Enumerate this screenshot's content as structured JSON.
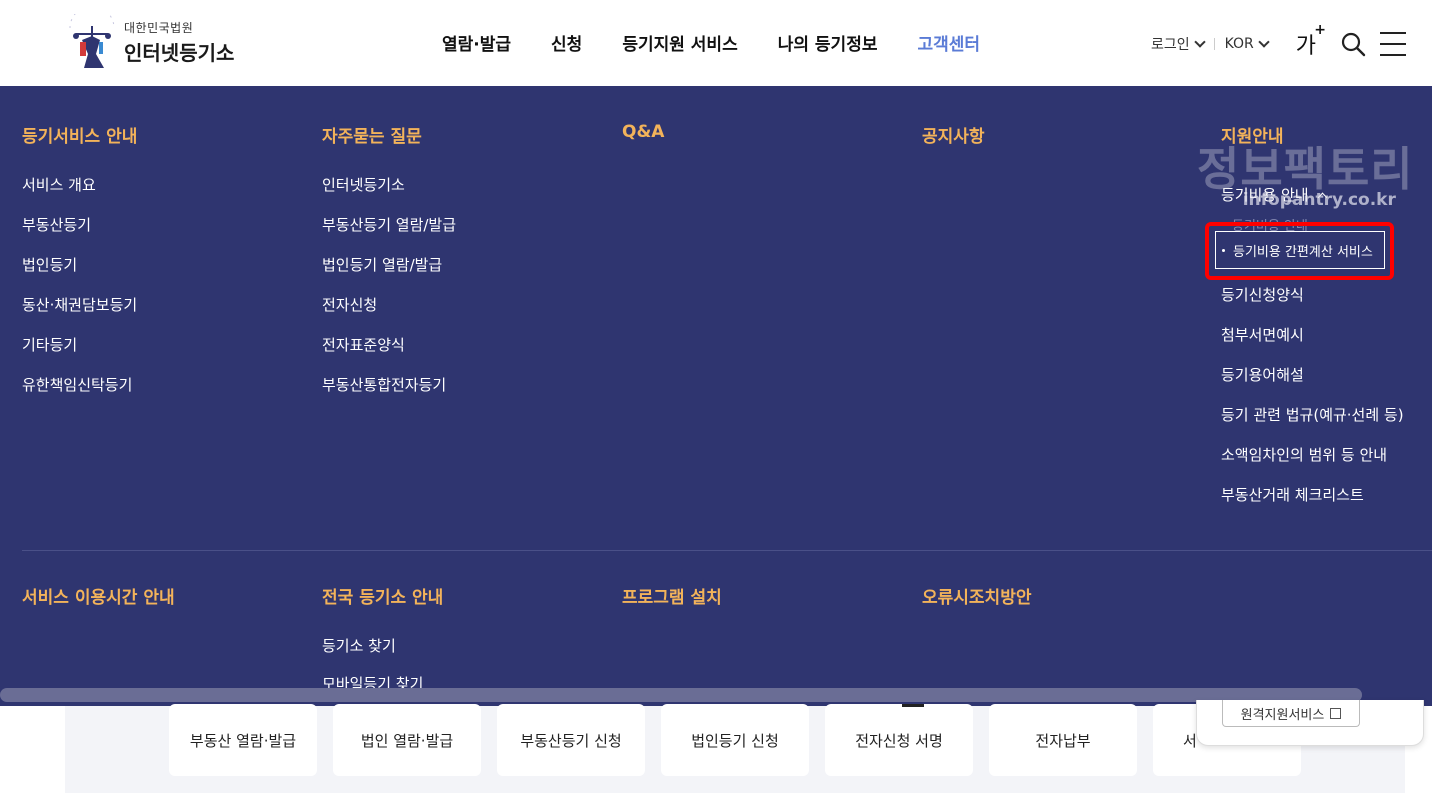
{
  "header": {
    "logo_sub": "대한민국법원",
    "logo_main": "인터넷등기소",
    "nav": [
      "열람·발급",
      "신청",
      "등기지원 서비스",
      "나의 등기정보",
      "고객센터"
    ],
    "active_nav": "고객센터",
    "login_label": "로그인",
    "lang_label": "KOR",
    "font_size_label": "가",
    "font_size_plus": "+"
  },
  "mega_menu": {
    "columns": [
      {
        "title": "등기서비스 안내",
        "items": [
          "서비스 개요",
          "부동산등기",
          "법인등기",
          "동산·채권담보등기",
          "기타등기",
          "유한책임신탁등기"
        ]
      },
      {
        "title": "자주묻는 질문",
        "items": [
          "인터넷등기소",
          "부동산등기 열람/발급",
          "법인등기 열람/발급",
          "전자신청",
          "전자표준양식",
          "부동산통합전자등기"
        ]
      },
      {
        "title": "Q&A",
        "items": []
      },
      {
        "title": "공지사항",
        "items": []
      },
      {
        "title": "지원안내",
        "open_item": "등기비용 안내",
        "sub_ghost": "등기비용 안내",
        "sub_selected": "등기비용 간편계산 서비스",
        "items": [
          "등기신청양식",
          "첨부서면예시",
          "등기용어해설",
          "등기 관련 법규(예규·선례 등)",
          "소액임차인의 범위 등 안내",
          "부동산거래 체크리스트"
        ]
      }
    ],
    "bottom_columns": [
      {
        "title": "서비스 이용시간 안내",
        "items": []
      },
      {
        "title": "전국 등기소 안내",
        "items": [
          "등기소 찾기"
        ],
        "peek": "모바일등기 찾기"
      },
      {
        "title": "프로그램 설치",
        "items": []
      },
      {
        "title": "오류시조치방안",
        "items": []
      }
    ]
  },
  "watermark": {
    "main": "정보팩토리",
    "sub": "infopantry.co.kr"
  },
  "quick_links": [
    "부동산 열람·발급",
    "법인 열람·발급",
    "부동산등기 신청",
    "법인등기 신청",
    "전자신청 서명",
    "전자납부",
    "서"
  ],
  "remote_support": {
    "label": "원격지원서비스"
  },
  "colors": {
    "menu_bg": "#2f3570",
    "menu_title": "#f3b35a",
    "active_nav": "#5a7bd6",
    "highlight": "#ff0000"
  }
}
